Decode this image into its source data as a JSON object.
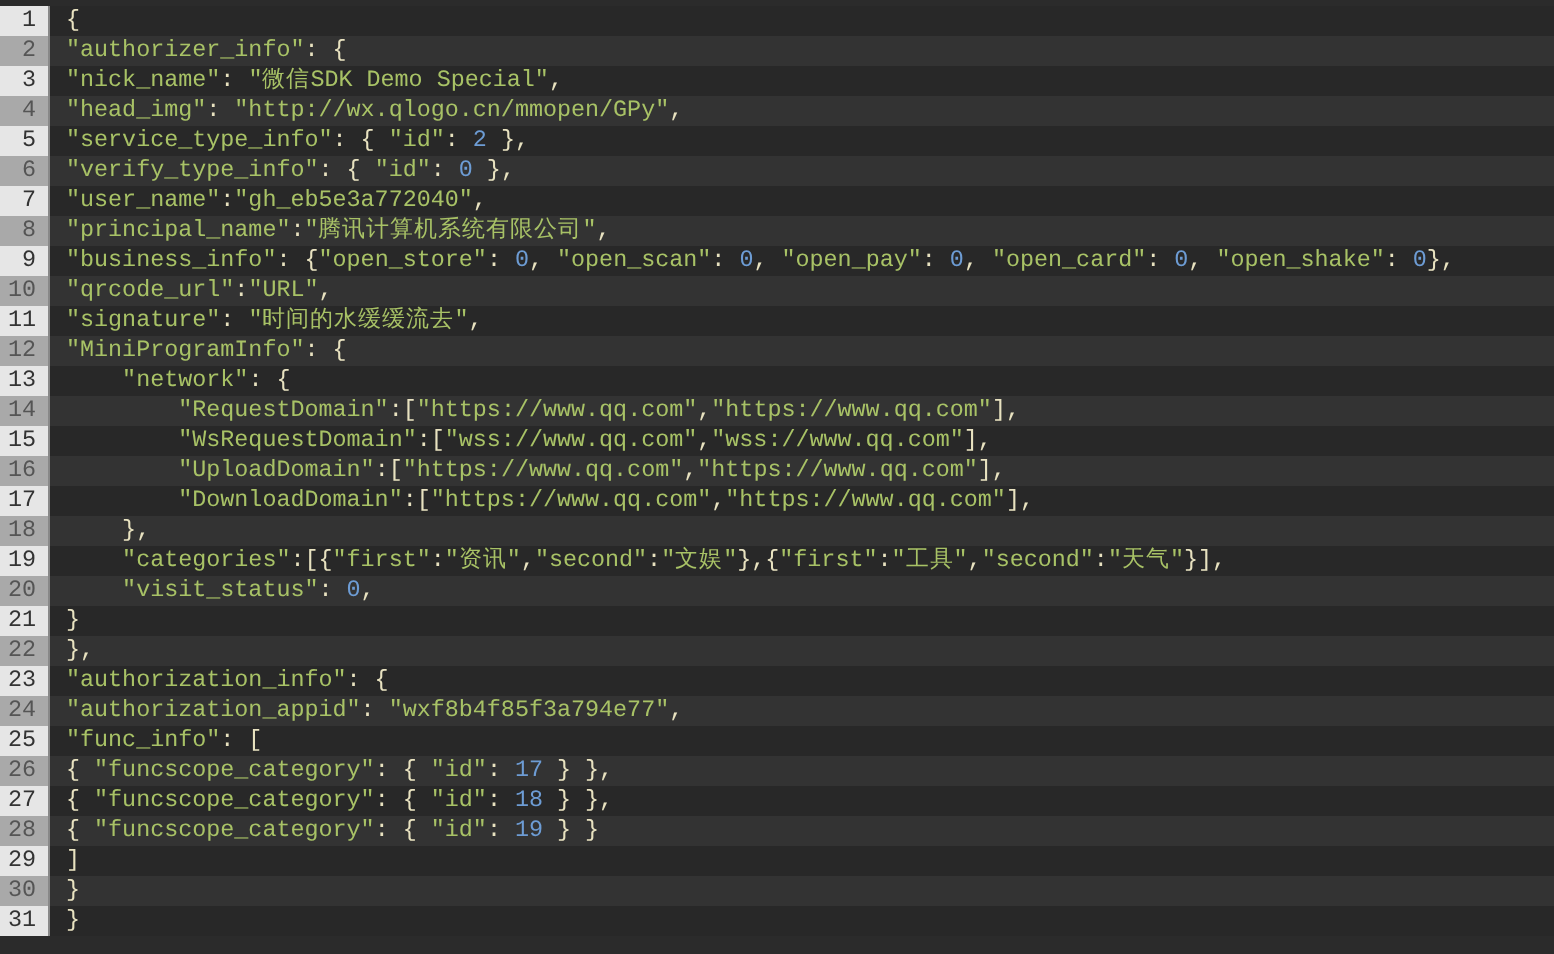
{
  "editor": {
    "lines": [
      {
        "number": "1",
        "tokens": [
          {
            "kind": "p",
            "text": "{"
          }
        ]
      },
      {
        "number": "2",
        "tokens": [
          {
            "kind": "s",
            "text": "\"authorizer_info\""
          },
          {
            "kind": "p",
            "text": ": {"
          }
        ]
      },
      {
        "number": "3",
        "tokens": [
          {
            "kind": "s",
            "text": "\"nick_name\""
          },
          {
            "kind": "p",
            "text": ": "
          },
          {
            "kind": "s",
            "text": "\"微信SDK Demo Special\""
          },
          {
            "kind": "p",
            "text": ","
          }
        ]
      },
      {
        "number": "4",
        "tokens": [
          {
            "kind": "s",
            "text": "\"head_img\""
          },
          {
            "kind": "p",
            "text": ": "
          },
          {
            "kind": "s",
            "text": "\"http://wx.qlogo.cn/mmopen/GPy\""
          },
          {
            "kind": "p",
            "text": ","
          }
        ]
      },
      {
        "number": "5",
        "tokens": [
          {
            "kind": "s",
            "text": "\"service_type_info\""
          },
          {
            "kind": "p",
            "text": ": { "
          },
          {
            "kind": "s",
            "text": "\"id\""
          },
          {
            "kind": "p",
            "text": ": "
          },
          {
            "kind": "n",
            "text": "2"
          },
          {
            "kind": "p",
            "text": " },"
          }
        ]
      },
      {
        "number": "6",
        "tokens": [
          {
            "kind": "s",
            "text": "\"verify_type_info\""
          },
          {
            "kind": "p",
            "text": ": { "
          },
          {
            "kind": "s",
            "text": "\"id\""
          },
          {
            "kind": "p",
            "text": ": "
          },
          {
            "kind": "n",
            "text": "0"
          },
          {
            "kind": "p",
            "text": " },"
          }
        ]
      },
      {
        "number": "7",
        "tokens": [
          {
            "kind": "s",
            "text": "\"user_name\""
          },
          {
            "kind": "p",
            "text": ":"
          },
          {
            "kind": "s",
            "text": "\"gh_eb5e3a772040\""
          },
          {
            "kind": "p",
            "text": ","
          }
        ]
      },
      {
        "number": "8",
        "tokens": [
          {
            "kind": "s",
            "text": "\"principal_name\""
          },
          {
            "kind": "p",
            "text": ":"
          },
          {
            "kind": "s",
            "text": "\"腾讯计算机系统有限公司\""
          },
          {
            "kind": "p",
            "text": ","
          }
        ]
      },
      {
        "number": "9",
        "tokens": [
          {
            "kind": "s",
            "text": "\"business_info\""
          },
          {
            "kind": "p",
            "text": ": {"
          },
          {
            "kind": "s",
            "text": "\"open_store\""
          },
          {
            "kind": "p",
            "text": ": "
          },
          {
            "kind": "n",
            "text": "0"
          },
          {
            "kind": "p",
            "text": ", "
          },
          {
            "kind": "s",
            "text": "\"open_scan\""
          },
          {
            "kind": "p",
            "text": ": "
          },
          {
            "kind": "n",
            "text": "0"
          },
          {
            "kind": "p",
            "text": ", "
          },
          {
            "kind": "s",
            "text": "\"open_pay\""
          },
          {
            "kind": "p",
            "text": ": "
          },
          {
            "kind": "n",
            "text": "0"
          },
          {
            "kind": "p",
            "text": ", "
          },
          {
            "kind": "s",
            "text": "\"open_card\""
          },
          {
            "kind": "p",
            "text": ": "
          },
          {
            "kind": "n",
            "text": "0"
          },
          {
            "kind": "p",
            "text": ", "
          },
          {
            "kind": "s",
            "text": "\"open_shake\""
          },
          {
            "kind": "p",
            "text": ": "
          },
          {
            "kind": "n",
            "text": "0"
          },
          {
            "kind": "p",
            "text": "},"
          }
        ]
      },
      {
        "number": "10",
        "tokens": [
          {
            "kind": "s",
            "text": "\"qrcode_url\""
          },
          {
            "kind": "p",
            "text": ":"
          },
          {
            "kind": "s",
            "text": "\"URL\""
          },
          {
            "kind": "p",
            "text": ","
          }
        ]
      },
      {
        "number": "11",
        "tokens": [
          {
            "kind": "s",
            "text": "\"signature\""
          },
          {
            "kind": "p",
            "text": ": "
          },
          {
            "kind": "s",
            "text": "\"时间的水缓缓流去\""
          },
          {
            "kind": "p",
            "text": ","
          }
        ]
      },
      {
        "number": "12",
        "tokens": [
          {
            "kind": "s",
            "text": "\"MiniProgramInfo\""
          },
          {
            "kind": "p",
            "text": ": {"
          }
        ]
      },
      {
        "number": "13",
        "tokens": [
          {
            "kind": "s",
            "text": "    \"network\""
          },
          {
            "kind": "p",
            "text": ": {"
          }
        ]
      },
      {
        "number": "14",
        "tokens": [
          {
            "kind": "s",
            "text": "        \"RequestDomain\""
          },
          {
            "kind": "p",
            "text": ":["
          },
          {
            "kind": "s",
            "text": "\"https://www.qq.com\""
          },
          {
            "kind": "p",
            "text": ","
          },
          {
            "kind": "s",
            "text": "\"https://www.qq.com\""
          },
          {
            "kind": "p",
            "text": "],"
          }
        ]
      },
      {
        "number": "15",
        "tokens": [
          {
            "kind": "s",
            "text": "        \"WsRequestDomain\""
          },
          {
            "kind": "p",
            "text": ":["
          },
          {
            "kind": "s",
            "text": "\"wss://www.qq.com\""
          },
          {
            "kind": "p",
            "text": ","
          },
          {
            "kind": "s",
            "text": "\"wss://www.qq.com\""
          },
          {
            "kind": "p",
            "text": "],"
          }
        ]
      },
      {
        "number": "16",
        "tokens": [
          {
            "kind": "s",
            "text": "        \"UploadDomain\""
          },
          {
            "kind": "p",
            "text": ":["
          },
          {
            "kind": "s",
            "text": "\"https://www.qq.com\""
          },
          {
            "kind": "p",
            "text": ","
          },
          {
            "kind": "s",
            "text": "\"https://www.qq.com\""
          },
          {
            "kind": "p",
            "text": "],"
          }
        ]
      },
      {
        "number": "17",
        "tokens": [
          {
            "kind": "s",
            "text": "        \"DownloadDomain\""
          },
          {
            "kind": "p",
            "text": ":["
          },
          {
            "kind": "s",
            "text": "\"https://www.qq.com\""
          },
          {
            "kind": "p",
            "text": ","
          },
          {
            "kind": "s",
            "text": "\"https://www.qq.com\""
          },
          {
            "kind": "p",
            "text": "],"
          }
        ]
      },
      {
        "number": "18",
        "tokens": [
          {
            "kind": "p",
            "text": "    },"
          }
        ]
      },
      {
        "number": "19",
        "tokens": [
          {
            "kind": "s",
            "text": "    \"categories\""
          },
          {
            "kind": "p",
            "text": ":[{"
          },
          {
            "kind": "s",
            "text": "\"first\""
          },
          {
            "kind": "p",
            "text": ":"
          },
          {
            "kind": "s",
            "text": "\"资讯\""
          },
          {
            "kind": "p",
            "text": ","
          },
          {
            "kind": "s",
            "text": "\"second\""
          },
          {
            "kind": "p",
            "text": ":"
          },
          {
            "kind": "s",
            "text": "\"文娱\""
          },
          {
            "kind": "p",
            "text": "},{"
          },
          {
            "kind": "s",
            "text": "\"first\""
          },
          {
            "kind": "p",
            "text": ":"
          },
          {
            "kind": "s",
            "text": "\"工具\""
          },
          {
            "kind": "p",
            "text": ","
          },
          {
            "kind": "s",
            "text": "\"second\""
          },
          {
            "kind": "p",
            "text": ":"
          },
          {
            "kind": "s",
            "text": "\"天气\""
          },
          {
            "kind": "p",
            "text": "}],"
          }
        ]
      },
      {
        "number": "20",
        "tokens": [
          {
            "kind": "s",
            "text": "    \"visit_status\""
          },
          {
            "kind": "p",
            "text": ": "
          },
          {
            "kind": "n",
            "text": "0"
          },
          {
            "kind": "p",
            "text": ","
          }
        ]
      },
      {
        "number": "21",
        "tokens": [
          {
            "kind": "p",
            "text": "}"
          }
        ]
      },
      {
        "number": "22",
        "tokens": [
          {
            "kind": "p",
            "text": "},"
          }
        ]
      },
      {
        "number": "23",
        "tokens": [
          {
            "kind": "s",
            "text": "\"authorization_info\""
          },
          {
            "kind": "p",
            "text": ": {"
          }
        ]
      },
      {
        "number": "24",
        "tokens": [
          {
            "kind": "s",
            "text": "\"authorization_appid\""
          },
          {
            "kind": "p",
            "text": ": "
          },
          {
            "kind": "s",
            "text": "\"wxf8b4f85f3a794e77\""
          },
          {
            "kind": "p",
            "text": ","
          }
        ]
      },
      {
        "number": "25",
        "tokens": [
          {
            "kind": "s",
            "text": "\"func_info\""
          },
          {
            "kind": "p",
            "text": ": ["
          }
        ]
      },
      {
        "number": "26",
        "tokens": [
          {
            "kind": "p",
            "text": "{ "
          },
          {
            "kind": "s",
            "text": "\"funcscope_category\""
          },
          {
            "kind": "p",
            "text": ": { "
          },
          {
            "kind": "s",
            "text": "\"id\""
          },
          {
            "kind": "p",
            "text": ": "
          },
          {
            "kind": "n",
            "text": "17"
          },
          {
            "kind": "p",
            "text": " } },"
          }
        ]
      },
      {
        "number": "27",
        "tokens": [
          {
            "kind": "p",
            "text": "{ "
          },
          {
            "kind": "s",
            "text": "\"funcscope_category\""
          },
          {
            "kind": "p",
            "text": ": { "
          },
          {
            "kind": "s",
            "text": "\"id\""
          },
          {
            "kind": "p",
            "text": ": "
          },
          {
            "kind": "n",
            "text": "18"
          },
          {
            "kind": "p",
            "text": " } },"
          }
        ]
      },
      {
        "number": "28",
        "tokens": [
          {
            "kind": "p",
            "text": "{ "
          },
          {
            "kind": "s",
            "text": "\"funcscope_category\""
          },
          {
            "kind": "p",
            "text": ": { "
          },
          {
            "kind": "s",
            "text": "\"id\""
          },
          {
            "kind": "p",
            "text": ": "
          },
          {
            "kind": "n",
            "text": "19"
          },
          {
            "kind": "p",
            "text": " } }"
          }
        ]
      },
      {
        "number": "29",
        "tokens": [
          {
            "kind": "p",
            "text": "]"
          }
        ]
      },
      {
        "number": "30",
        "tokens": [
          {
            "kind": "p",
            "text": "}"
          }
        ]
      },
      {
        "number": "31",
        "tokens": [
          {
            "kind": "p",
            "text": "}"
          }
        ]
      }
    ]
  }
}
